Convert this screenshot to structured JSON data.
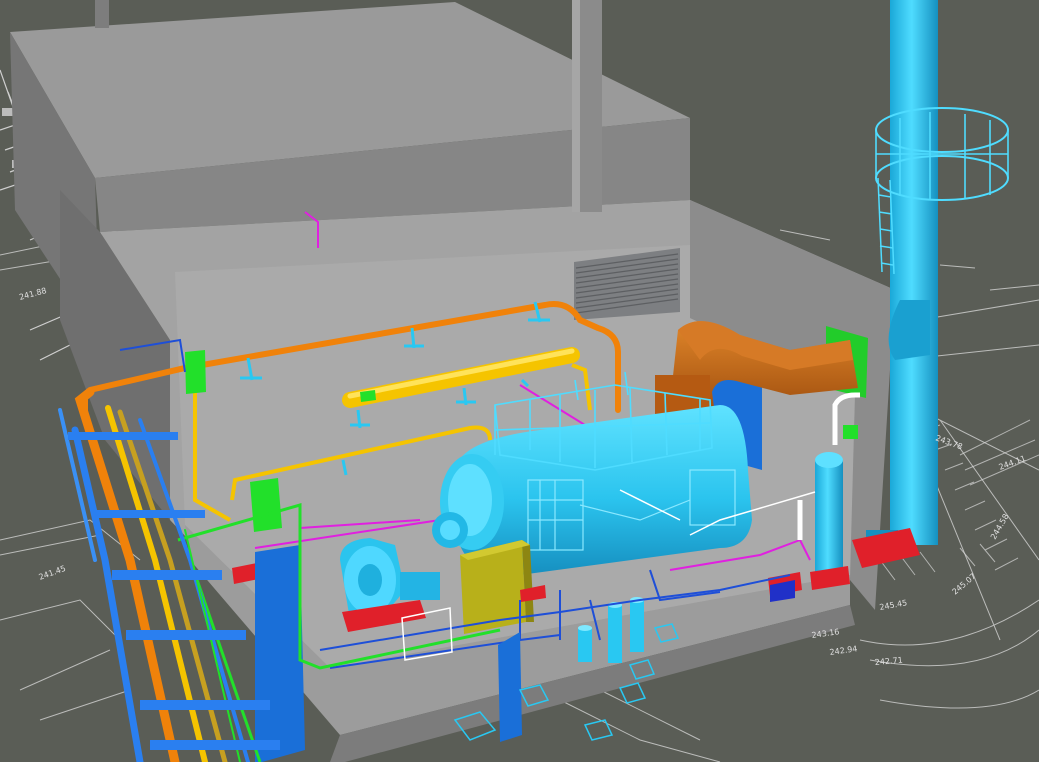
{
  "scene": {
    "colors": {
      "background": "#5a5d56",
      "building_light": "#a9a9a9",
      "building_mid": "#8f8f8f",
      "building_dark": "#6e6e6e",
      "cyan_equipment": "#29c8f2",
      "orange_pipe": "#f0820a",
      "yellow_pipe": "#f5c400",
      "brown_duct": "#c4610f",
      "green_flange": "#22e02a",
      "red_base": "#e0202a",
      "blue_pipe": "#1e6fe0",
      "magenta_line": "#e020e0",
      "olive_panel": "#b8b01a",
      "white_lines": "#e8e8e8"
    },
    "equipment": [
      "building",
      "chimney-stack",
      "boiler",
      "flue-duct",
      "louver-vent",
      "gas-header",
      "pump",
      "control-panel",
      "vertical-vessel",
      "gas-cylinders",
      "pipe-rack"
    ],
    "ground_labels": [
      "245.45",
      "245.07",
      "244.58",
      "244.11",
      "243.78",
      "243.16",
      "242.94",
      "242.71",
      "241.88",
      "241.45"
    ]
  }
}
